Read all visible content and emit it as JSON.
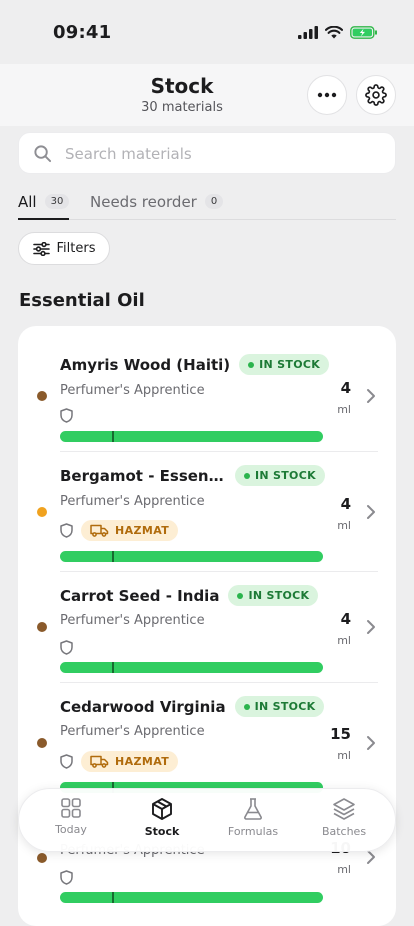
{
  "status_bar": {
    "time": "09:41"
  },
  "header": {
    "title": "Stock",
    "subtitle": "30 materials"
  },
  "search": {
    "placeholder": "Search materials",
    "value": ""
  },
  "tabs": [
    {
      "label": "All",
      "count": "30",
      "active": true
    },
    {
      "label": "Needs reorder",
      "count": "0",
      "active": false
    }
  ],
  "filters": {
    "label": "Filters"
  },
  "section": {
    "title": "Essential Oil"
  },
  "items": [
    {
      "name": "Amyris Wood (Haiti)",
      "status": "IN STOCK",
      "supplier": "Perfumer's Apprentice",
      "hazmat": "",
      "qty": "4",
      "unit": "ml",
      "dot_color": "#8a5a2b",
      "level": 1.0
    },
    {
      "name": "Bergamot - Essential…",
      "status": "IN STOCK",
      "supplier": "Perfumer's Apprentice",
      "hazmat": "HAZMAT",
      "qty": "4",
      "unit": "ml",
      "dot_color": "#f0a21f",
      "level": 1.0
    },
    {
      "name": "Carrot Seed - India",
      "status": "IN STOCK",
      "supplier": "Perfumer's Apprentice",
      "hazmat": "",
      "qty": "4",
      "unit": "ml",
      "dot_color": "#8a5a2b",
      "level": 1.0
    },
    {
      "name": "Cedarwood Virginia",
      "status": "IN STOCK",
      "supplier": "Perfumer's Apprentice",
      "hazmat": "HAZMAT",
      "qty": "15",
      "unit": "ml",
      "dot_color": "#8a5a2b",
      "level": 1.0
    },
    {
      "name": "",
      "status": "",
      "supplier": "Perfumer's Apprentice",
      "hazmat": "",
      "qty": "10",
      "unit": "ml",
      "dot_color": "#8a5a2b",
      "level": 1.0
    }
  ],
  "tabbar": [
    {
      "label": "Today",
      "icon": "grid-icon",
      "active": false
    },
    {
      "label": "Stock",
      "icon": "box-icon",
      "active": true
    },
    {
      "label": "Formulas",
      "icon": "flask-icon",
      "active": false
    },
    {
      "label": "Batches",
      "icon": "layers-icon",
      "active": false
    }
  ],
  "colors": {
    "accent_green": "#31cd61",
    "in_stock_bg": "#daf4de",
    "hazmat_bg": "#fdeed4"
  }
}
